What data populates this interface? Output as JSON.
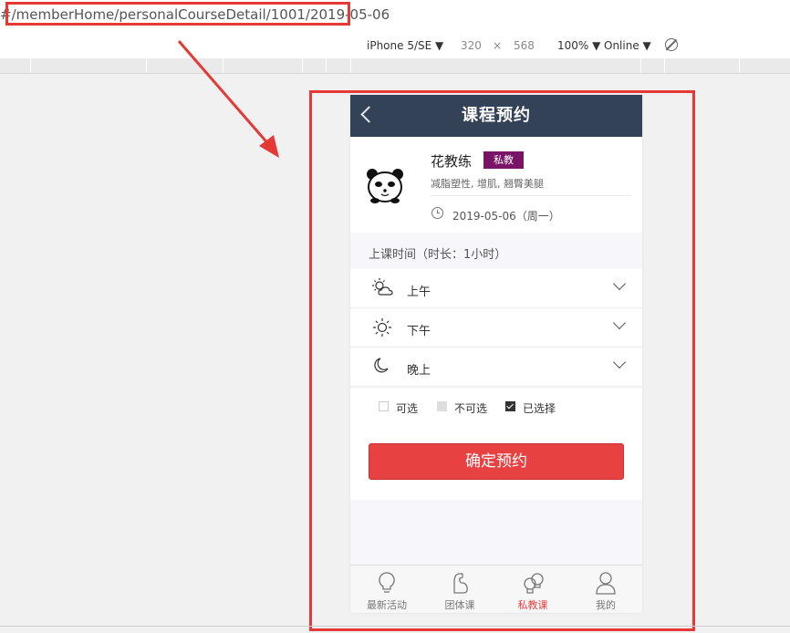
{
  "browser": {
    "url": "#/memberHome/personalCourseDetail/1001/2019-05-06"
  },
  "device_toolbar": {
    "device": "iPhone 5/SE ▼",
    "width": "320",
    "times": "×",
    "height": "568",
    "zoom": "100% ▼",
    "network": "Online ▼"
  },
  "app": {
    "title": "课程预约",
    "coach": {
      "name": "花教练",
      "badge": "私教",
      "tags": "减脂塑性, 增肌, 翘臀美腿",
      "date": "2019-05-06（周一）"
    },
    "section_label": "上课时间（时长：1小时）",
    "slots": [
      {
        "label": "上午",
        "icon": "cloud-sun-icon"
      },
      {
        "label": "下午",
        "icon": "sun-icon"
      },
      {
        "label": "晚上",
        "icon": "moon-icon"
      }
    ],
    "legend": {
      "available": "可选",
      "unavailable": "不可选",
      "selected": "已选择"
    },
    "confirm_button": "确定预约",
    "tabs": [
      {
        "label": "最新活动",
        "icon": "lightbulb-icon",
        "active": false
      },
      {
        "label": "团体课",
        "icon": "arm-muscle-icon",
        "active": false
      },
      {
        "label": "私教课",
        "icon": "boxing-gloves-icon",
        "active": true
      },
      {
        "label": "我的",
        "icon": "user-icon",
        "active": false
      }
    ]
  },
  "colors": {
    "header_bg": "#334257",
    "accent_red": "#e84141",
    "badge_purple": "#7a1466",
    "annotation_red": "#e53935"
  }
}
